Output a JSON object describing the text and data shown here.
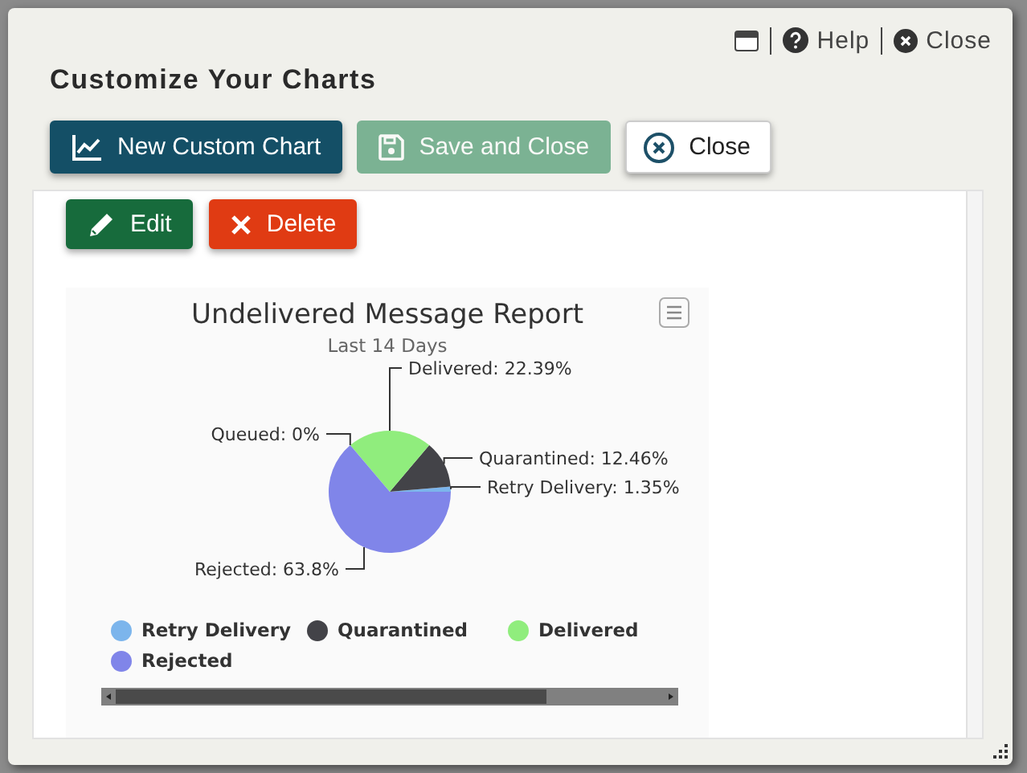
{
  "window": {
    "title": "Customize Your Charts"
  },
  "header_links": [
    {
      "kind": "window"
    },
    {
      "kind": "help",
      "label": "Help"
    },
    {
      "kind": "close",
      "label": "Close"
    }
  ],
  "toolbar": [
    {
      "kind": "chart",
      "label": "New Custom Chart",
      "disabled": false
    },
    {
      "kind": "save",
      "label": "Save and Close",
      "disabled": true
    },
    {
      "kind": "close",
      "label": "Close",
      "disabled": false
    }
  ],
  "chart_actions": [
    {
      "kind": "edit",
      "label": "Edit"
    },
    {
      "kind": "delete",
      "label": "Delete"
    }
  ],
  "chart": {
    "subtitle": "Last 14 Days",
    "chart_data": {
      "type": "pie",
      "title": "Undelivered Message Report",
      "values": [
        1.35,
        12.46,
        22.39,
        0,
        63.8
      ],
      "colors": [
        "#7cb5ec",
        "#434348",
        "#90ed7d",
        null,
        "#8085e9"
      ],
      "value_labels": [
        "Retry Delivery: 1.35%",
        "Quarantined: 12.46%",
        "Delivered: 22.39%",
        "Queued: 0%",
        "Rejected: 63.8%"
      ]
    },
    "legend": [
      {
        "label": "Retry Delivery",
        "color": "#7cb5ec"
      },
      {
        "label": "Quarantined",
        "color": "#434348"
      },
      {
        "label": "Delivered",
        "color": "#90ed7d"
      },
      {
        "label": "Rejected",
        "color": "#8085e9"
      }
    ]
  }
}
